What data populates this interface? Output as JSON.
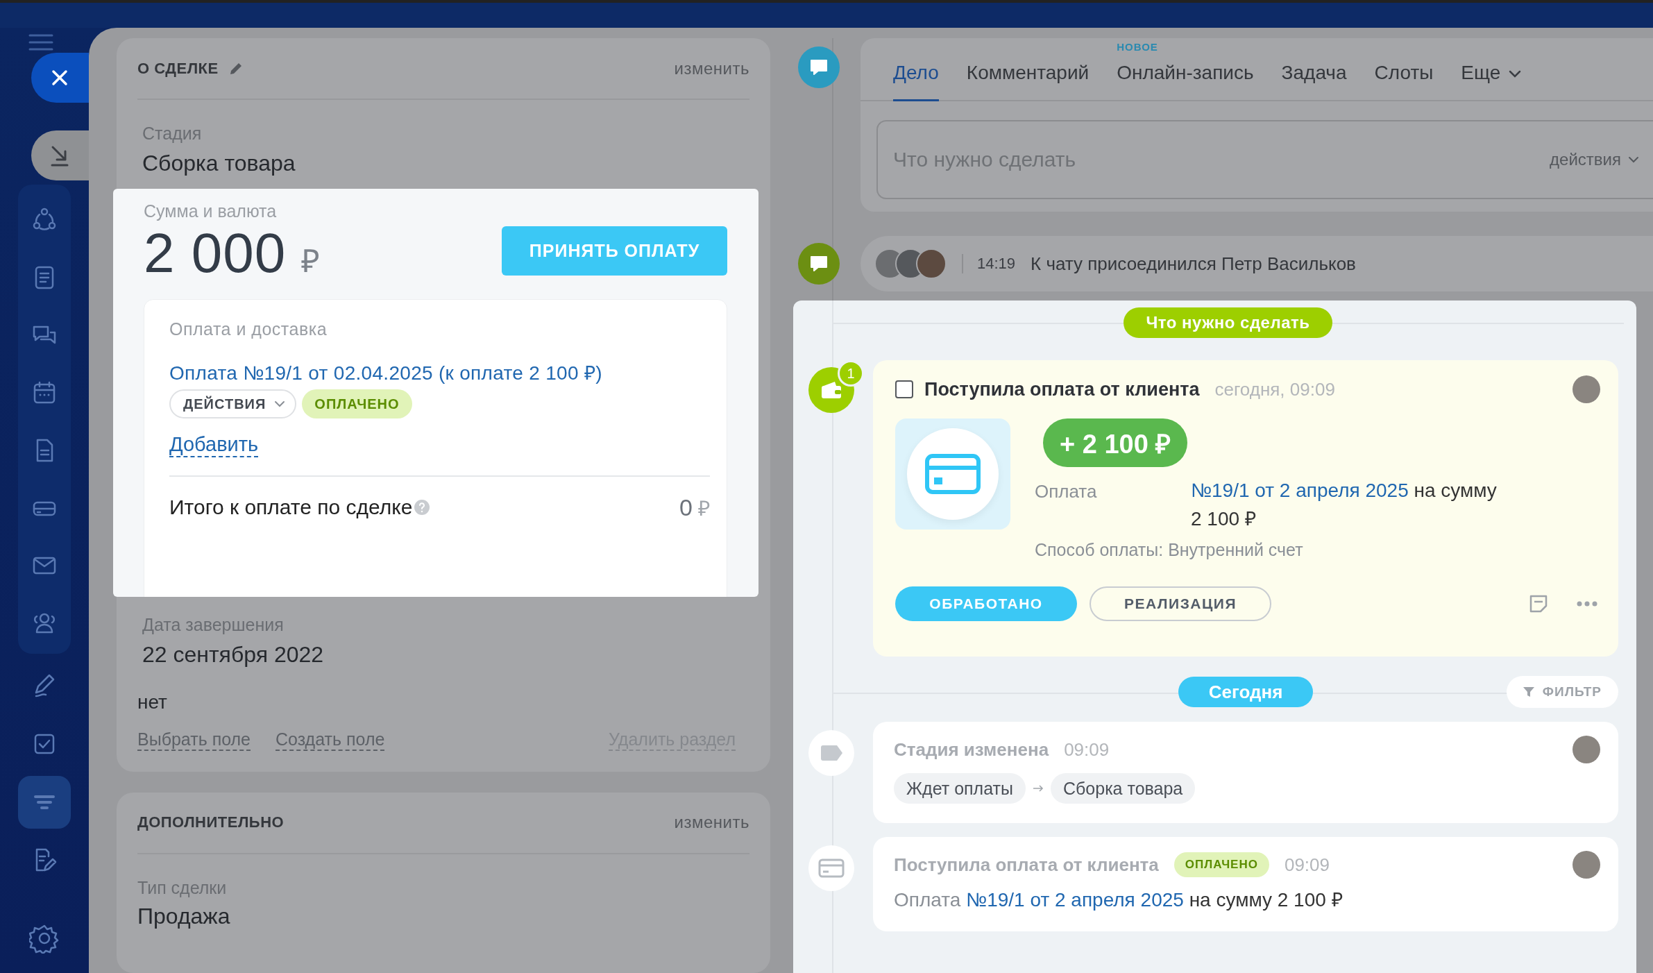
{
  "sidebar": {
    "items": [
      {
        "selected": false
      },
      {
        "selected": false
      },
      {
        "selected": false
      },
      {
        "selected": false
      },
      {
        "selected": false
      },
      {
        "selected": false
      },
      {
        "selected": false
      },
      {
        "selected": false
      },
      {
        "selected": false
      },
      {
        "selected": false
      },
      {
        "selected": true
      },
      {
        "selected": false
      }
    ]
  },
  "deal": {
    "title": "О СДЕЛКЕ",
    "edit_link": "изменить",
    "stage_label": "Стадия",
    "stage_value": "Сборка товара",
    "amount": {
      "label": "Сумма и валюта",
      "value": "2 000",
      "currency": "₽",
      "button": "ПРИНЯТЬ ОПЛАТУ"
    },
    "payment": {
      "title": "Оплата и доставка",
      "link": "Оплата №19/1 от 02.04.2025 (к оплате 2 100 ₽)",
      "actions": "ДЕЙСТВИЯ",
      "status": "ОПЛАЧЕНО",
      "add": "Добавить",
      "total_label": "Итого к оплате по сделке",
      "total_value": "0",
      "total_currency": "₽"
    },
    "close_label": "Дата завершения",
    "close_value": "22 сентября 2022",
    "extra_value": "нет",
    "links": [
      "Выбрать поле",
      "Создать поле"
    ],
    "delete_link": "Удалить раздел"
  },
  "additional": {
    "title": "ДОПОЛНИТЕЛЬНО",
    "edit_link": "изменить",
    "type_label": "Тип сделки",
    "type_value": "Продажа"
  },
  "editor": {
    "tabs": [
      {
        "label": "Дело",
        "selected": true,
        "kind": "plain"
      },
      {
        "label": "Комментарий",
        "selected": false,
        "kind": "plain"
      },
      {
        "label": "Онлайн-запись",
        "selected": false,
        "kind": "plain",
        "badge": "НОВОЕ"
      },
      {
        "label": "Задача",
        "selected": false,
        "kind": "plain"
      },
      {
        "label": "Слоты",
        "selected": false,
        "kind": "plain"
      },
      {
        "label": "Еще",
        "selected": false,
        "kind": "dropdown"
      }
    ],
    "placeholder": "Что нужно сделать",
    "actions": "действия"
  },
  "chat_event": {
    "time": "14:19",
    "text": "К чату присоединился Петр Васильков"
  },
  "todo_header": "Что нужно сделать",
  "todo": {
    "badge": "1",
    "done": false,
    "title": "Поступила оплата от клиента",
    "time": "сегодня, 09:09",
    "amount": "+ 2 100 ₽",
    "label": "Оплата",
    "link": "№19/1 от 2 апреля 2025",
    "after_link": "на сумму",
    "sum": "2 100 ₽",
    "method": "Способ оплаты: Внутренний счет",
    "buttons": [
      {
        "label": "ОБРАБОТАНО",
        "kind": "primary"
      },
      {
        "label": "РЕАЛИЗАЦИЯ",
        "kind": "secondary"
      }
    ]
  },
  "today_header": "Сегодня",
  "filter": "ФИЛЬТР",
  "history": [
    {
      "kind": "stage",
      "title": "Стадия изменена",
      "time": "09:09",
      "from": "Ждет оплаты",
      "to": "Сборка товара"
    },
    {
      "kind": "payment",
      "title": "Поступила оплата от клиента",
      "status": "ОПЛАЧЕНО",
      "time": "09:09",
      "label": "Оплата",
      "link": "№19/1 от 2 апреля 2025",
      "after_link": "на сумму 2 100 ₽"
    }
  ]
}
